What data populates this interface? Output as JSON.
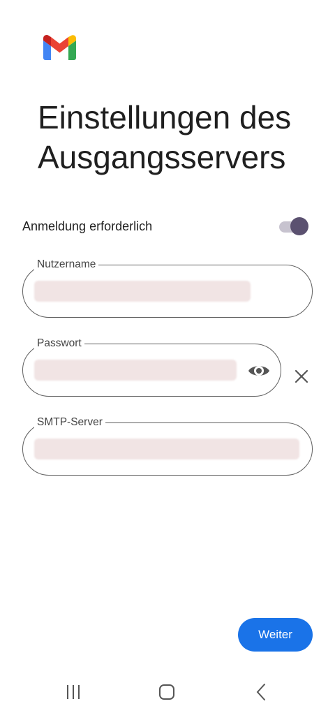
{
  "header": {
    "logo_icon": "gmail-logo",
    "title": "Einstellungen des Ausgangsservers"
  },
  "login_required": {
    "label": "Anmeldung erforderlich",
    "enabled": true
  },
  "fields": {
    "username": {
      "label": "Nutzername",
      "value": ""
    },
    "password": {
      "label": "Passwort",
      "value": "",
      "visibility_icon": "eye-icon",
      "clear_icon": "close-icon"
    },
    "smtp_server": {
      "label": "SMTP-Server",
      "value": ""
    }
  },
  "actions": {
    "next_label": "Weiter"
  },
  "colors": {
    "primary": "#1a73e8",
    "toggle_knob": "#5b5170",
    "toggle_track": "#c7c3cf"
  },
  "navbar": {
    "recents_icon": "recents-icon",
    "home_icon": "home-icon",
    "back_icon": "back-icon"
  }
}
